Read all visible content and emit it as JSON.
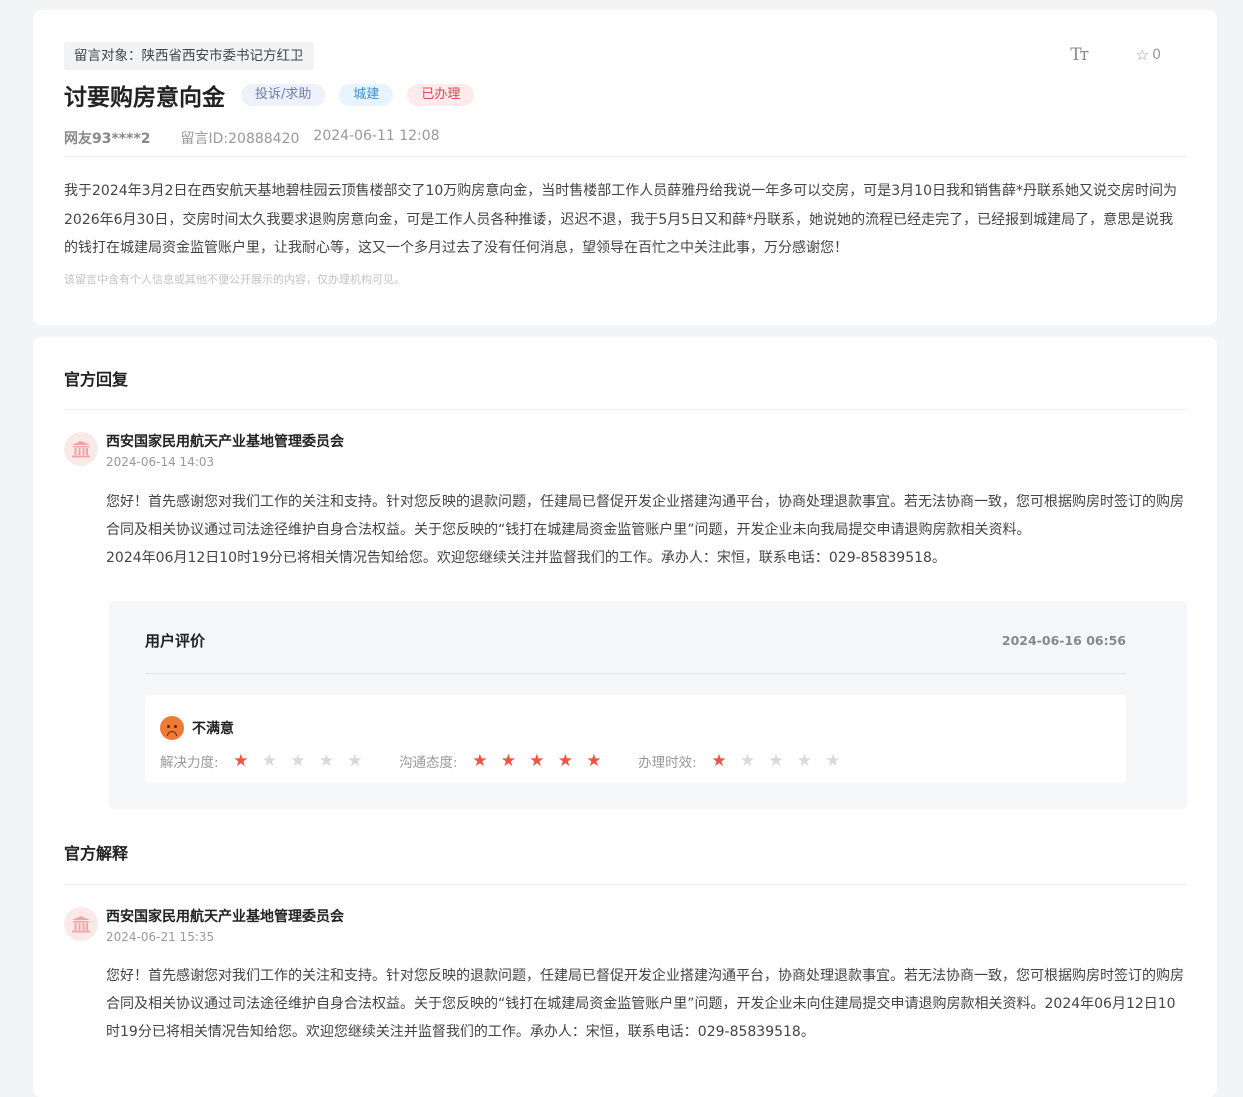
{
  "message": {
    "target_label": "留言对象：陕西省西安市委书记方红卫",
    "favorite_count": "0",
    "font_size_icon": "Tт",
    "title": "讨要购房意向金",
    "badges": {
      "type": "投诉/求助",
      "category": "城建",
      "status": "已办理"
    },
    "author": "网友93****2",
    "message_id": "留言ID:20888420",
    "datetime": "2024-06-11 12:08",
    "content": "我于2024年3月2日在西安航天基地碧桂园云顶售楼部交了10万购房意向金，当时售楼部工作人员薛雅丹给我说一年多可以交房，可是3月10日我和销售薛*丹联系她又说交房时间为2026年6月30日，交房时间太久我要求退购房意向金，可是工作人员各种推诿，迟迟不退，我于5月5日又和薛*丹联系，她说她的流程已经走完了，已经报到城建局了，意思是说我的钱打在城建局资金监管账户里，让我耐心等，这又一个多月过去了没有任何消息，望领导在百忙之中关注此事，万分感谢您！",
    "privacy_notice": "该留言中含有个人信息或其他不便公开展示的内容，仅办理机构可见。"
  },
  "official_reply": {
    "section_title": "官方回复",
    "org_name": "西安国家民用航天产业基地管理委员会",
    "datetime": "2024-06-14 14:03",
    "content": "您好！首先感谢您对我们工作的关注和支持。针对您反映的退款问题，任建局已督促开发企业搭建沟通平台，协商处理退款事宜。若无法协商一致，您可根据购房时签订的购房合同及相关协议通过司法途径维护自身合法权益。关于您反映的“钱打在城建局资金监管账户里”问题，开发企业未向我局提交申请退购房款相关资料。",
    "content2": "2024年06月12日10时19分已将相关情况告知给您。欢迎您继续关注并监督我们的工作。承办人：宋恒，联系电话：029-85839518。"
  },
  "user_evaluation": {
    "title": "用户评价",
    "datetime": "2024-06-16 06:56",
    "mood": "不满意",
    "ratings": [
      {
        "label": "解决力度:",
        "score": 1,
        "max": 5
      },
      {
        "label": "沟通态度:",
        "score": 5,
        "max": 5
      },
      {
        "label": "办理时效:",
        "score": 1,
        "max": 5
      }
    ]
  },
  "official_explanation": {
    "section_title": "官方解释",
    "org_name": "西安国家民用航天产业基地管理委员会",
    "datetime": "2024-06-21 15:35",
    "content": "您好！首先感谢您对我们工作的关注和支持。针对您反映的退款问题，任建局已督促开发企业搭建沟通平台，协商处理退款事宜。若无法协商一致，您可根据购房时签订的购房合同及相关协议通过司法途径维护自身合法权益。关于您反映的“钱打在城建局资金监管账户里”问题，开发企业未向住建局提交申请退购房款相关资料。2024年06月12日10时19分已将相关情况告知给您。欢迎您继续关注并监督我们的工作。承办人：宋恒，联系电话：029-85839518。"
  },
  "colors": {
    "accent_red": "#e0484f",
    "star_on": "#f0533f",
    "star_off": "#d9d9d9",
    "mood_face": "#f07a35"
  },
  "icons": {
    "favorite": "star-outline-icon",
    "font_size": "font-size-icon",
    "org_avatar": "government-building-icon",
    "mood": "unhappy-face-icon"
  }
}
